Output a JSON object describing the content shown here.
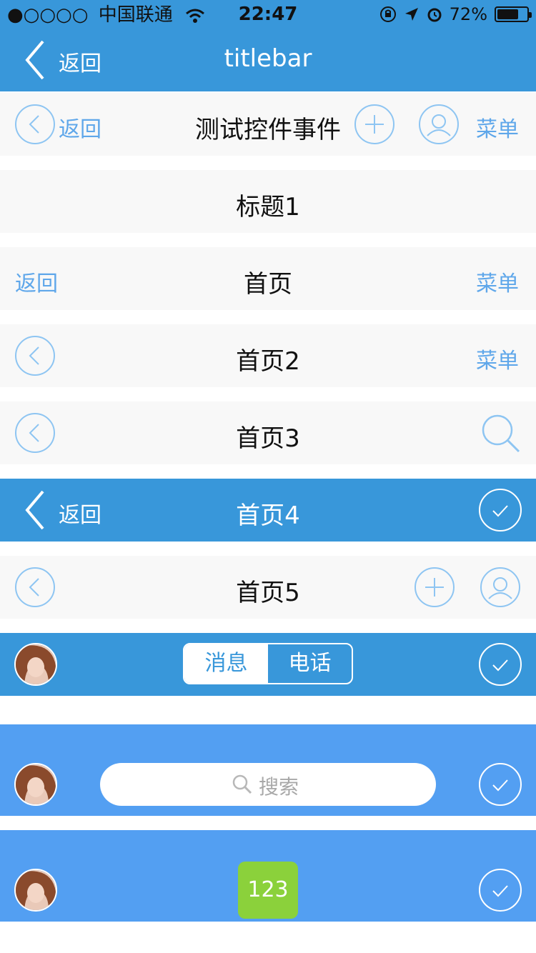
{
  "status": {
    "signal_dots": "●○○○○",
    "carrier": "中国联通",
    "time": "22:47",
    "battery_pct": "72%",
    "battery_level": 0.72
  },
  "titlebar": {
    "back": "返回",
    "title": "titlebar"
  },
  "bars": [
    {
      "back": "返回",
      "title": "测试控件事件",
      "menu": "菜单"
    },
    {
      "title": "标题1"
    },
    {
      "back": "返回",
      "title": "首页",
      "menu": "菜单"
    },
    {
      "title": "首页2",
      "menu": "菜单"
    },
    {
      "title": "首页3"
    },
    {
      "back": "返回",
      "title": "首页4"
    },
    {
      "title": "首页5"
    },
    {
      "seg_left": "消息",
      "seg_right": "电话"
    },
    {
      "search_placeholder": "搜索"
    },
    {
      "badge": "123"
    }
  ],
  "colors": {
    "primary_blue": "#3897da",
    "light_blue": "#539ff2",
    "icon_blue": "#8ec5f2",
    "badge_green": "#8bd13b"
  }
}
